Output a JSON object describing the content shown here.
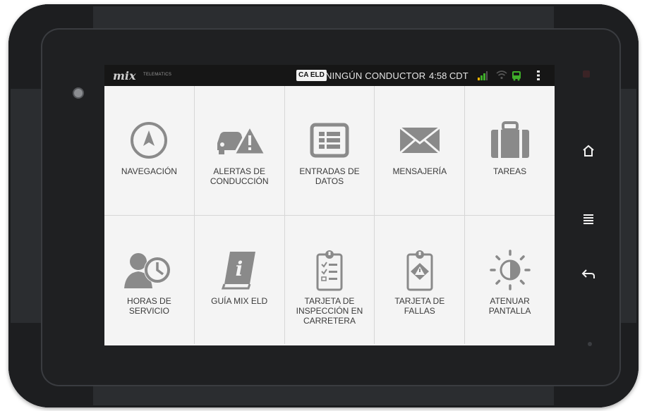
{
  "statusbar": {
    "logo": "mix",
    "logo_sub": "TELEMATICS",
    "ca_badge": "CA ELD",
    "driver": "NINGÚN CONDUCTOR",
    "time": "4:58 CDT"
  },
  "tiles": [
    {
      "id": "navegacion",
      "label": "NAVEGACIÓN",
      "icon": "compass-icon"
    },
    {
      "id": "alertas",
      "label": "ALERTAS DE\nCONDUCCIÓN",
      "icon": "car-warning-icon"
    },
    {
      "id": "entradas",
      "label": "ENTRADAS DE\nDATOS",
      "icon": "data-grid-icon"
    },
    {
      "id": "mensajeria",
      "label": "MENSAJERÍA",
      "icon": "envelope-icon"
    },
    {
      "id": "tareas",
      "label": "TAREAS",
      "icon": "briefcase-icon"
    },
    {
      "id": "horas",
      "label": "HORAS DE\nSERVICIO",
      "icon": "person-clock-icon"
    },
    {
      "id": "guia",
      "label": "GUÍA MIX ELD",
      "icon": "info-book-icon"
    },
    {
      "id": "inspeccion",
      "label": "TARJETA DE\nINSPECCIÓN EN\nCARRETERA",
      "icon": "checklist-clipboard-icon"
    },
    {
      "id": "fallas",
      "label": "TARJETA DE\nFALLAS",
      "icon": "warning-clipboard-icon"
    },
    {
      "id": "atenuar",
      "label": "ATENUAR\nPANTALLA",
      "icon": "brightness-icon"
    }
  ],
  "hardware": {
    "home_icon": "home-icon",
    "menu_icon": "menu-icon",
    "back_icon": "back-icon"
  }
}
